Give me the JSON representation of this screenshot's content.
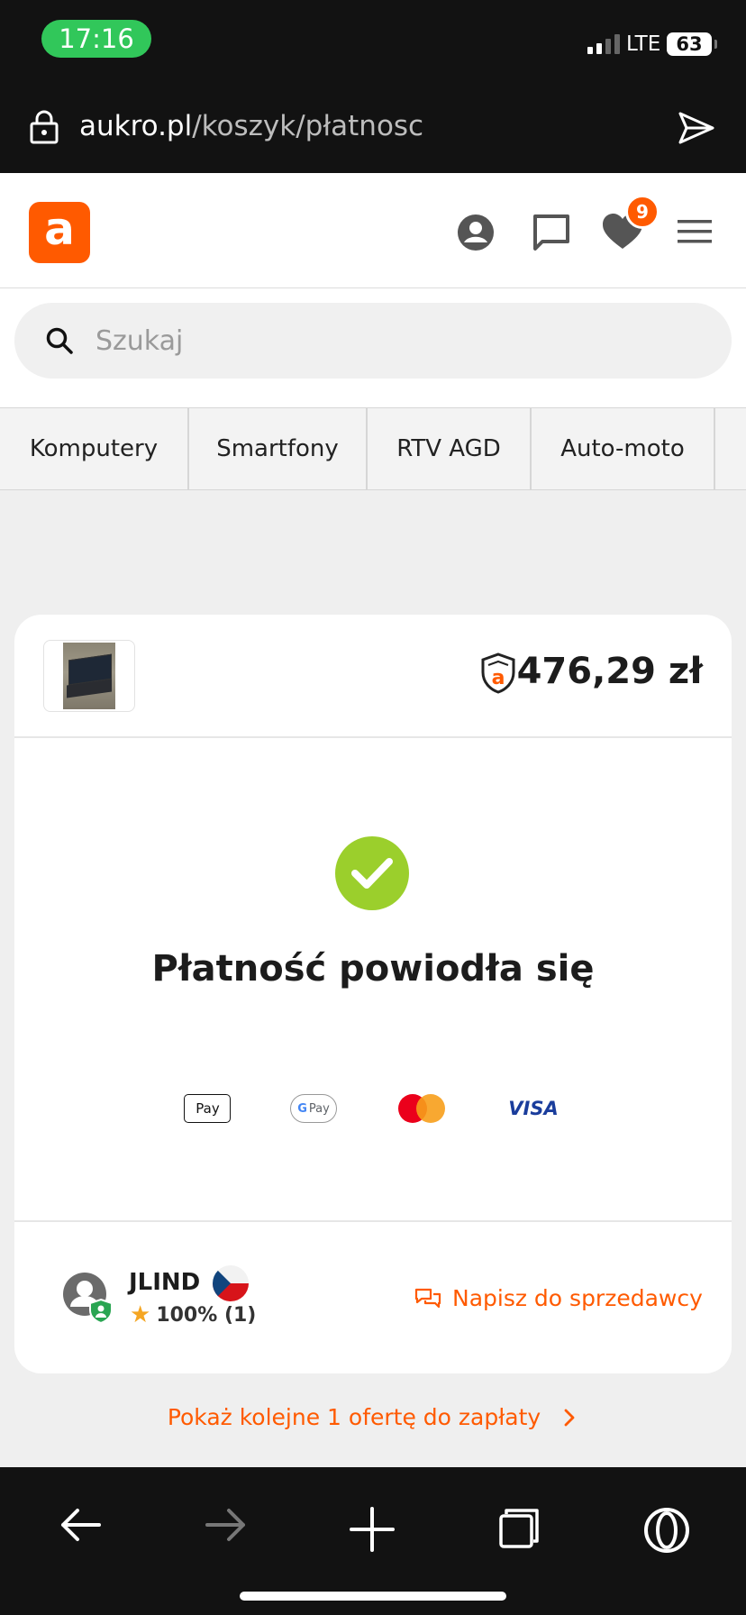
{
  "status_bar": {
    "time": "17:16",
    "network": "LTE",
    "battery": "63"
  },
  "url_bar": {
    "domain": "aukro.pl",
    "path": "/koszyk/płatnosc"
  },
  "header": {
    "logo_letter": "a",
    "wishlist_count": "9",
    "brand_color": "#ff5a00"
  },
  "search": {
    "placeholder": "Szukaj"
  },
  "categories": [
    "Komputery",
    "Smartfony",
    "RTV AGD",
    "Auto-moto"
  ],
  "order": {
    "price": "476,29 zł",
    "status": "Płatność powiodła się",
    "payment_methods": {
      "apple_pay": "Pay",
      "google_pay": "Pay",
      "visa": "VISA"
    }
  },
  "seller": {
    "name": "JLIND",
    "rating": "100% (1)",
    "contact_label": "Napisz do sprzedawcy"
  },
  "more_offers": "Pokaż kolejne 1 ofertę do zapłaty",
  "colors": {
    "accent": "#ff5a00",
    "success": "#9bcf2c",
    "dark_bar": "#121212"
  }
}
